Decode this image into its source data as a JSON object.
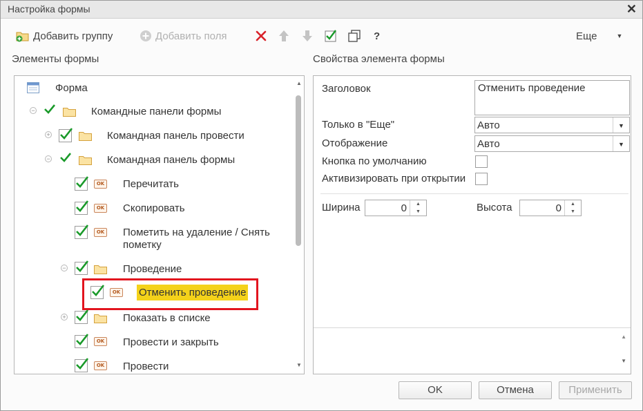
{
  "window": {
    "title": "Настройка формы"
  },
  "toolbar": {
    "add_group": "Добавить группу",
    "add_fields": "Добавить поля",
    "help": "?",
    "more": "Еще"
  },
  "left_panel": {
    "title": "Элементы формы"
  },
  "right_panel": {
    "title": "Свойства элемента формы"
  },
  "tree": {
    "items": [
      {
        "label": "Форма"
      },
      {
        "label": "Командные панели формы"
      },
      {
        "label": "Командная панель провести"
      },
      {
        "label": "Командная панель формы"
      },
      {
        "label": "Перечитать"
      },
      {
        "label": "Скопировать"
      },
      {
        "label": "Пометить на удаление / Снять"
      },
      {
        "label": "пометку"
      },
      {
        "label": "Проведение"
      },
      {
        "label": "Отменить проведение"
      },
      {
        "label": "Показать в списке"
      },
      {
        "label": "Провести и закрыть"
      },
      {
        "label": "Провести"
      }
    ],
    "ok_text": "OK"
  },
  "properties": {
    "title_label": "Заголовок",
    "title_value": "Отменить проведение",
    "only_more_label": "Только в \"Еще\"",
    "only_more_value": "Авто",
    "display_label": "Отображение",
    "display_value": "Авто",
    "default_button_label": "Кнопка по умолчанию",
    "activate_label": "Активизировать при открытии",
    "width_label": "Ширина",
    "width_value": "0",
    "height_label": "Высота",
    "height_value": "0"
  },
  "buttons": {
    "ok": "OK",
    "cancel": "Отмена",
    "apply": "Применить"
  },
  "colors": {
    "highlight": "#f4d21a",
    "selection_border": "#e2141e",
    "check": "#1a9a2a"
  }
}
